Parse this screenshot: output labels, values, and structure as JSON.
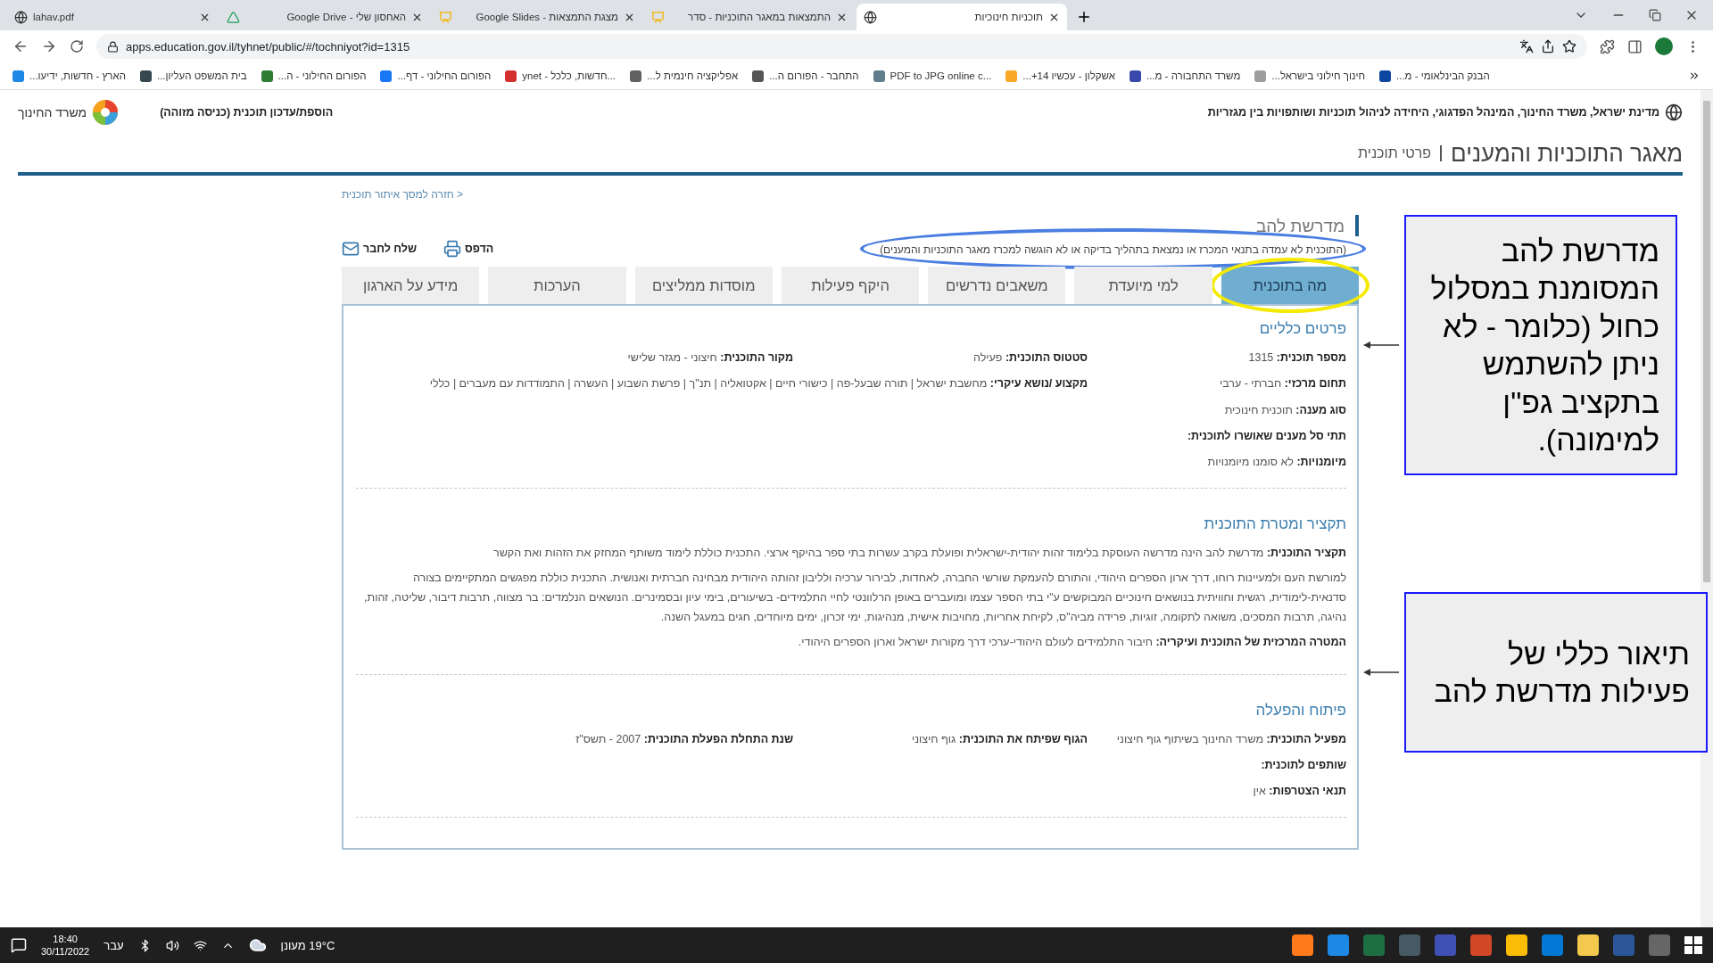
{
  "browser": {
    "tabs": [
      {
        "title": "תוכניות חינוכיות",
        "kind": "web",
        "selected": true
      },
      {
        "title": "התמצאות במאגר התוכניות - סדר",
        "kind": "slides",
        "selected": false
      },
      {
        "title": "Google Slides - מצגת התמצאות",
        "kind": "slides",
        "selected": false
      },
      {
        "title": "Google Drive - האחסון שלי",
        "kind": "drive",
        "selected": false
      },
      {
        "title": "lahav.pdf",
        "kind": "web",
        "selected": false
      }
    ],
    "address": "apps.education.gov.il/tyhnet/public/#/tochniyot?id=1315",
    "bookmarks": [
      {
        "title": "הבנק הבינלאומי - מ...",
        "color": "#0d47a1"
      },
      {
        "title": "חינוך חילוני בישראל...",
        "color": "#9e9e9e"
      },
      {
        "title": "משרד התחבורה - מ...",
        "color": "#3949ab"
      },
      {
        "title": "אשקלון - עכשיו 14+...",
        "color": "#f9a825"
      },
      {
        "title": "PDF to JPG online c...",
        "color": "#607d8b"
      },
      {
        "title": "התחבר - הפורום ה...",
        "color": "#555555"
      },
      {
        "title": "אפליקציה חינמית ל...",
        "color": "#616161"
      },
      {
        "title": "ynet - חדשות, כלכל...",
        "color": "#d32f2f"
      },
      {
        "title": "הפורום החילוני - דף...",
        "color": "#1877f2"
      },
      {
        "title": "הפורום החילוני - ה...",
        "color": "#2e7d32"
      },
      {
        "title": "בית המשפט העליון...",
        "color": "#37474f"
      },
      {
        "title": "הארץ - חדשות, ידיעו...",
        "color": "#1e88e5"
      }
    ]
  },
  "header": {
    "agency": "מדינת ישראל, משרד החינוך, המינהל הפדגוגי, היחידה לניהול תוכניות ושותפויות בין מגזריות",
    "entry_link": "הוספת/עדכון תוכנית (כניסה מזוהה)",
    "ministry": "משרד החינוך"
  },
  "page_title": "מאגר התוכניות והמענים",
  "page_subtitle": "פרטי תוכנית",
  "back_link": "< חזרה למסך איתור תוכנית",
  "program": {
    "name": "מדרשת להב",
    "note": {
      "text": "(התוכנית לא עמדה בתנאי המכרז או נמצאת בתהליך בדיקה או לא הוגשה למכרז מאגר התוכניות והמענים)",
      "circled": true
    },
    "actions": [
      {
        "label": "הדפס",
        "kind": "print"
      },
      {
        "label": "שלח לחבר",
        "kind": "email"
      }
    ]
  },
  "program_tabs": [
    {
      "label": "מה בתוכנית",
      "selected": true,
      "circled": true
    },
    {
      "label": "למי מיועדת",
      "selected": false,
      "circled": false
    },
    {
      "label": "משאבים נדרשים",
      "selected": false,
      "circled": false
    },
    {
      "label": "היקף פעילות",
      "selected": false,
      "circled": false
    },
    {
      "label": "מוסדות ממליצים",
      "selected": false,
      "circled": false
    },
    {
      "label": "הערכות",
      "selected": false,
      "circled": false
    },
    {
      "label": "מידע על הארגון",
      "selected": false,
      "circled": false
    }
  ],
  "general": {
    "heading": "פרטים כלליים",
    "rows": [
      [
        {
          "label": "מספר תוכנית:",
          "value": "1315"
        },
        {
          "label": "סטטוס התוכנית:",
          "value": "פעילה"
        },
        {
          "label": "מקור התוכנית:",
          "value": "חיצוני - מגזר שלישי"
        }
      ],
      [
        {
          "label": "תחום מרכזי:",
          "value": "חברתי - ערבי"
        },
        {
          "label": "מקצוע /נושא עיקרי:",
          "value": "מחשבת ישראל | תורה שבעל-פה | כישורי חיים | אקטואליה | תנ\"ך | פרשת השבוע | העשרה | התמודדות עם מעברים | כללי"
        }
      ],
      [
        {
          "label": "סוג מענה:",
          "value": "תוכנית חינוכית"
        }
      ],
      [
        {
          "label": "תתי סל מענים שאושרו לתוכנית:"
        }
      ],
      [
        {
          "label": "מיומנויות:",
          "value": "לא סומנו מיומנויות"
        }
      ]
    ]
  },
  "summary": {
    "heading": "תקציר ומטרת התוכנית",
    "paragraphs": [
      {
        "label": "תקציר התוכנית:",
        "value": "מדרשת להב הינה מדרשה העוסקת בלימוד זהות יהודית-ישראלית ופועלת בקרב עשרות בתי ספר בהיקף ארצי. התכנית כוללת לימוד משותף המחזק את הזהות ואת הקשר"
      },
      {
        "value": "למורשת העם ולמעיינות רוחו, דרך ארון הספרים היהודי, והתורם להעמקת שורשי החברה, לאחדות, לבירור ערכיה ולליבון זהותה היהודית מבחינה חברתית ואנושית. התכנית כוללת מפגשים המתקיימים בצורה סדנאית-לימודית, רגשית וחוויתית בנושאים חינוכיים המבוקשים ע\"י בתי הספר עצמו ומועברים באופן הרלוונטי לחיי התלמידים- בשיעורים, בימי עיון ובסמינרים. הנושאים הנלמדים: בר מצווה, תרבות דיבור, שליטה, זהות, נהיגה, תרבות המסכים, משואה לתקומה, זוגיות, פרידה מביה\"ס, לקיחת אחריות, מחויבות אישית, מנהיגות, ימי זכרון, ימים מיוחדים, חגים במעגל השנה."
      },
      {
        "label": "המטרה המרכזית של התוכנית ועיקריה:",
        "value": "חיבור התלמידים לעולם היהודי-ערכי דרך מקורות ישראל וארון הספרים היהודי."
      }
    ]
  },
  "development": {
    "heading": "פיתוח והפעלה",
    "rows": [
      [
        {
          "label": "מפעיל התוכנית:",
          "value": "משרד החינוך בשיתוף גוף חיצוני"
        },
        {
          "label": "הגוף שפיתח את התוכנית:",
          "value": "גוף חיצוני"
        },
        {
          "label": "שנת התחלת הפעלת התוכנית:",
          "value": "2007 - תשס\"ז"
        }
      ],
      [
        {
          "label": "שותפים לתוכנית:"
        }
      ],
      [
        {
          "label": "תנאי הצטרפות:",
          "value": "אין"
        }
      ]
    ]
  },
  "callouts": [
    {
      "text": "מדרשת להב המסומנת במסלול כחול (כלומר - לא ניתן להשתמש בתקציב גפ\"ן למימונה)."
    },
    {
      "text": "תיאור כללי של פעילות מדרשת להב"
    }
  ],
  "taskbar": {
    "time": "18:40",
    "date": "30/11/2022",
    "language": "עבר",
    "temperature": "19°C",
    "weather": "מעונן"
  }
}
